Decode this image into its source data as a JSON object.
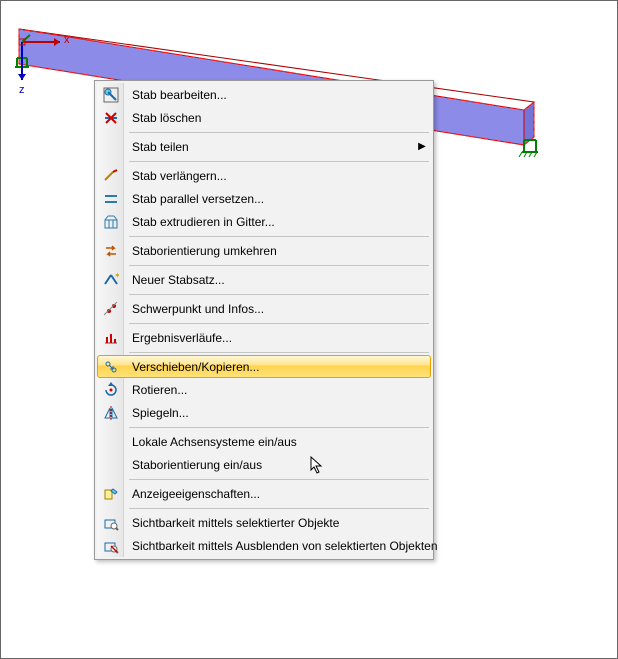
{
  "axes": {
    "x_label": "x",
    "z_label": "z"
  },
  "context_menu": {
    "items": [
      {
        "id": "edit-member",
        "label": "Stab bearbeiten...",
        "icon": "edit-member-icon"
      },
      {
        "id": "delete-member",
        "label": "Stab löschen",
        "icon": "delete-member-icon"
      },
      {
        "sep": true
      },
      {
        "id": "divide-member",
        "label": "Stab teilen",
        "icon": "",
        "submenu": true
      },
      {
        "sep": true
      },
      {
        "id": "extend-member",
        "label": "Stab verlängern...",
        "icon": "extend-member-icon"
      },
      {
        "id": "offset-parallel",
        "label": "Stab parallel versetzen...",
        "icon": "parallel-offset-icon"
      },
      {
        "id": "extrude-grid",
        "label": "Stab extrudieren in Gitter...",
        "icon": "extrude-grid-icon"
      },
      {
        "sep": true
      },
      {
        "id": "reverse-orient",
        "label": "Staborientierung umkehren",
        "icon": "reverse-orient-icon"
      },
      {
        "sep": true
      },
      {
        "id": "new-memberset",
        "label": "Neuer Stabsatz...",
        "icon": "new-set-icon"
      },
      {
        "sep": true
      },
      {
        "id": "centroid-info",
        "label": "Schwerpunkt und Infos...",
        "icon": "centroid-icon"
      },
      {
        "sep": true
      },
      {
        "id": "result-diagrams",
        "label": "Ergebnisverläufe...",
        "icon": "result-diagram-icon"
      },
      {
        "sep": true
      },
      {
        "id": "move-copy",
        "label": "Verschieben/Kopieren...",
        "icon": "move-copy-icon",
        "hover": true
      },
      {
        "id": "rotate",
        "label": "Rotieren...",
        "icon": "rotate-icon"
      },
      {
        "id": "mirror",
        "label": "Spiegeln...",
        "icon": "mirror-icon"
      },
      {
        "sep": true
      },
      {
        "id": "local-axes",
        "label": "Lokale Achsensysteme ein/aus",
        "icon": ""
      },
      {
        "id": "orient-onoff",
        "label": "Staborientierung ein/aus",
        "icon": ""
      },
      {
        "sep": true
      },
      {
        "id": "display-props",
        "label": "Anzeigeeigenschaften...",
        "icon": "display-props-icon"
      },
      {
        "sep": true
      },
      {
        "id": "vis-by-selected",
        "label": "Sichtbarkeit mittels selektierter Objekte",
        "icon": "visibility-keep-icon"
      },
      {
        "id": "vis-hide-selected",
        "label": "Sichtbarkeit mittels Ausblenden von selektierten Objekten",
        "icon": "visibility-hide-icon"
      }
    ]
  }
}
